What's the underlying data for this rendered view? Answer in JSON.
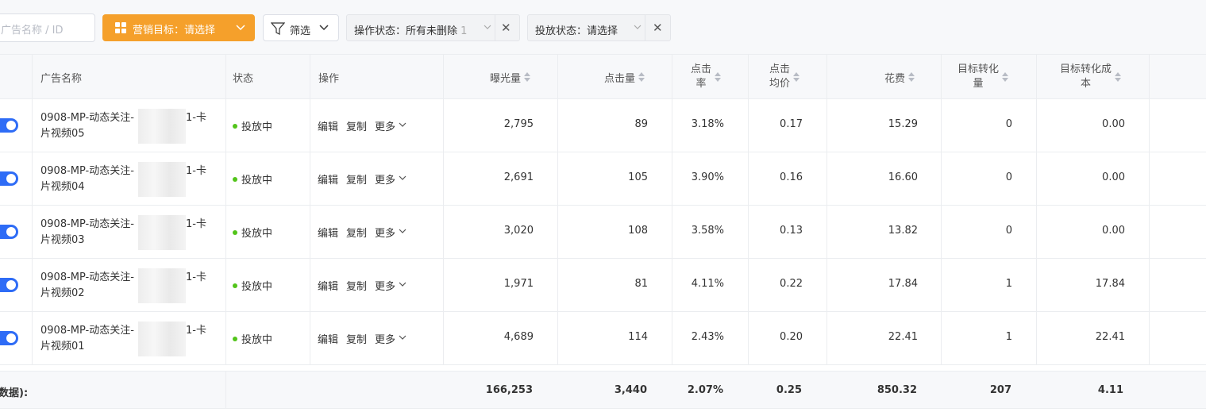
{
  "toolbar": {
    "search_placeholder": "广告名称 / ID",
    "goal_label": "营销目标：请选择",
    "filter_label": "筛选",
    "op_status_label": "操作状态：所有未删除",
    "op_status_extra": "1",
    "delivery_status_label": "投放状态：请选择",
    "accent_color": "#f5a02b"
  },
  "table": {
    "headers": {
      "name": "广告名称",
      "status": "状态",
      "ops": "操作",
      "impressions": "曝光量",
      "clicks": "点击量",
      "ctr_line1": "点击",
      "ctr_line2": "率",
      "cpc_line1": "点击",
      "cpc_line2": "均价",
      "cost": "花费",
      "conv_line1": "目标转化",
      "conv_line2": "量",
      "cpa_line1": "目标转化成",
      "cpa_line2": "本"
    },
    "action_labels": {
      "edit": "编辑",
      "copy": "复制",
      "more": "更多"
    },
    "rows": [
      {
        "name_prefix": "0908-MP-动态关注-",
        "name_suffix": "1-卡",
        "name_line2": "片视频05",
        "status": "投放中",
        "impressions": "2,795",
        "clicks": "89",
        "ctr": "3.18%",
        "cpc": "0.17",
        "cost": "15.29",
        "conv": "0",
        "cpa": "0.00"
      },
      {
        "name_prefix": "0908-MP-动态关注-",
        "name_suffix": "1-卡",
        "name_line2": "片视频04",
        "status": "投放中",
        "impressions": "2,691",
        "clicks": "105",
        "ctr": "3.90%",
        "cpc": "0.16",
        "cost": "16.60",
        "conv": "0",
        "cpa": "0.00"
      },
      {
        "name_prefix": "0908-MP-动态关注-",
        "name_suffix": "1-卡",
        "name_line2": "片视频03",
        "status": "投放中",
        "impressions": "3,020",
        "clicks": "108",
        "ctr": "3.58%",
        "cpc": "0.13",
        "cost": "13.82",
        "conv": "0",
        "cpa": "0.00"
      },
      {
        "name_prefix": "0908-MP-动态关注-",
        "name_suffix": "1-卡",
        "name_line2": "片视频02",
        "status": "投放中",
        "impressions": "1,971",
        "clicks": "81",
        "ctr": "4.11%",
        "cpc": "0.22",
        "cost": "17.84",
        "conv": "1",
        "cpa": "17.84"
      },
      {
        "name_prefix": "0908-MP-动态关注-",
        "name_suffix": "1-卡",
        "name_line2": "片视频01",
        "status": "投放中",
        "impressions": "4,689",
        "clicks": "114",
        "ctr": "2.43%",
        "cpc": "0.20",
        "cost": "22.41",
        "conv": "1",
        "cpa": "22.41"
      }
    ]
  },
  "footer": {
    "label": "数据):",
    "impressions": "166,253",
    "clicks": "3,440",
    "ctr": "2.07%",
    "cpc": "0.25",
    "cost": "850.32",
    "conv": "207",
    "cpa": "4.11"
  }
}
